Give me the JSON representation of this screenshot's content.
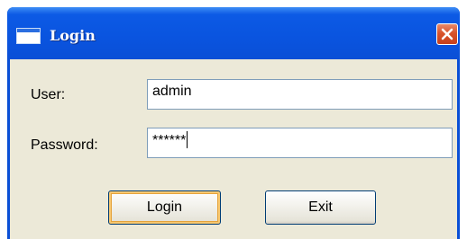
{
  "window": {
    "title": "Login",
    "icon": "window-app-icon",
    "close_icon": "close-icon"
  },
  "form": {
    "user_label": "User:",
    "user_value": "admin",
    "password_label": "Password:",
    "password_value": "******"
  },
  "buttons": {
    "login_label": "Login",
    "exit_label": "Exit"
  },
  "colors": {
    "titlebar": "#0a54df",
    "client": "#ece9d8",
    "close_button": "#d9532b"
  }
}
